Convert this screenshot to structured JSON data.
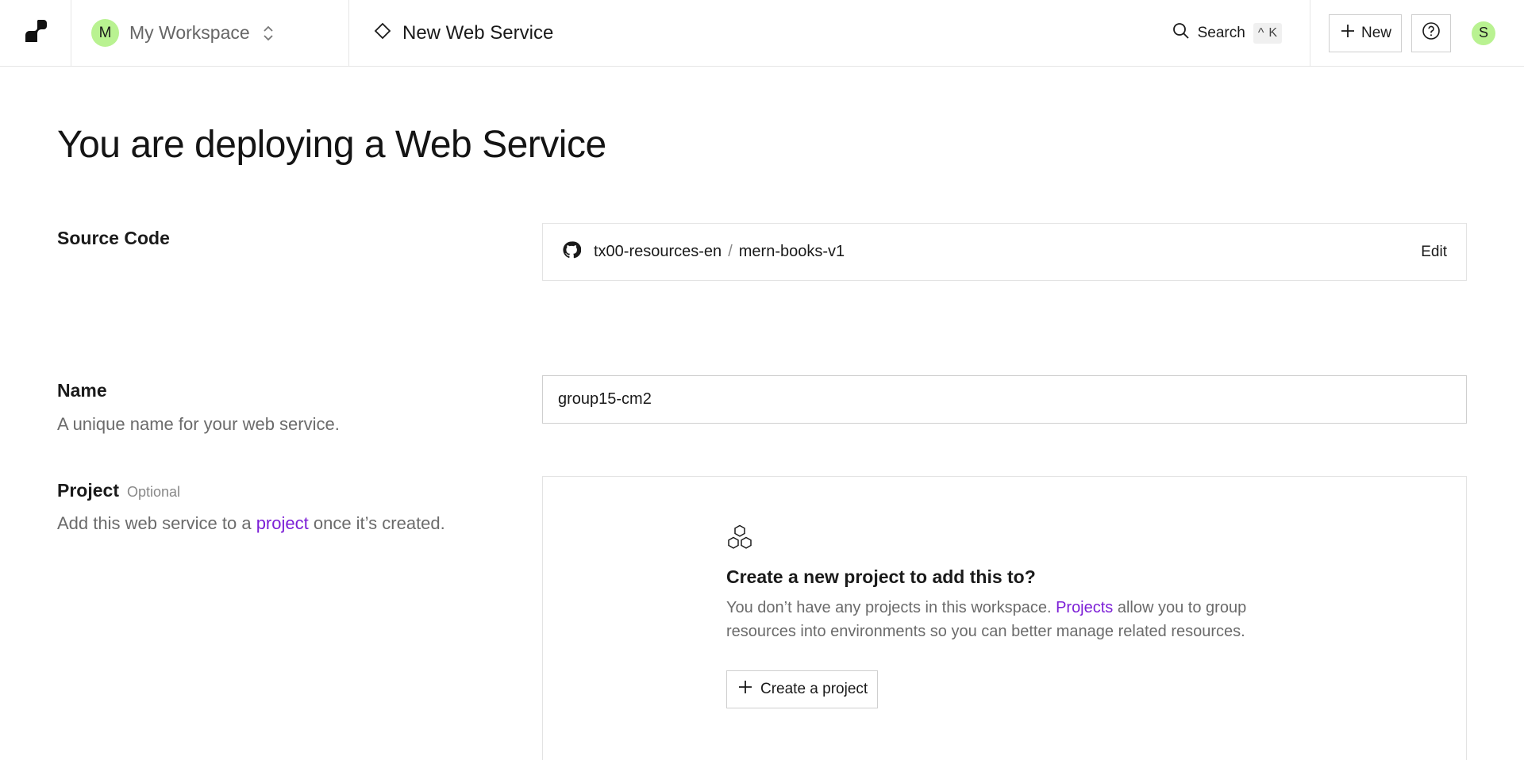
{
  "header": {
    "workspace_initial": "M",
    "workspace_name": "My Workspace",
    "breadcrumb_title": "New Web Service",
    "search_label": "Search",
    "search_shortcut_modifier": "^",
    "search_shortcut_key": "K",
    "new_button_label": "New",
    "user_initial": "S"
  },
  "page": {
    "title": "You are deploying a Web Service"
  },
  "source_code": {
    "label": "Source Code",
    "repo_owner": "tx00-resources-en",
    "separator": "/",
    "repo_name": "mern-books-v1",
    "edit_label": "Edit"
  },
  "name_field": {
    "label": "Name",
    "description": "A unique name for your web service.",
    "value": "group15-cm2"
  },
  "project": {
    "label": "Project",
    "optional_tag": "Optional",
    "description_prefix": "Add this web service to a ",
    "description_link": "project",
    "description_suffix": " once it’s created.",
    "empty_title": "Create a new project to add this to?",
    "empty_desc_prefix": "You don’t have any projects in this workspace. ",
    "empty_desc_link": "Projects",
    "empty_desc_suffix": " allow you to group resources into environments so you can better manage related resources.",
    "create_button_label": "Create a project"
  },
  "colors": {
    "accent_link": "#7c1fd6",
    "avatar_bg": "#b9f291"
  }
}
